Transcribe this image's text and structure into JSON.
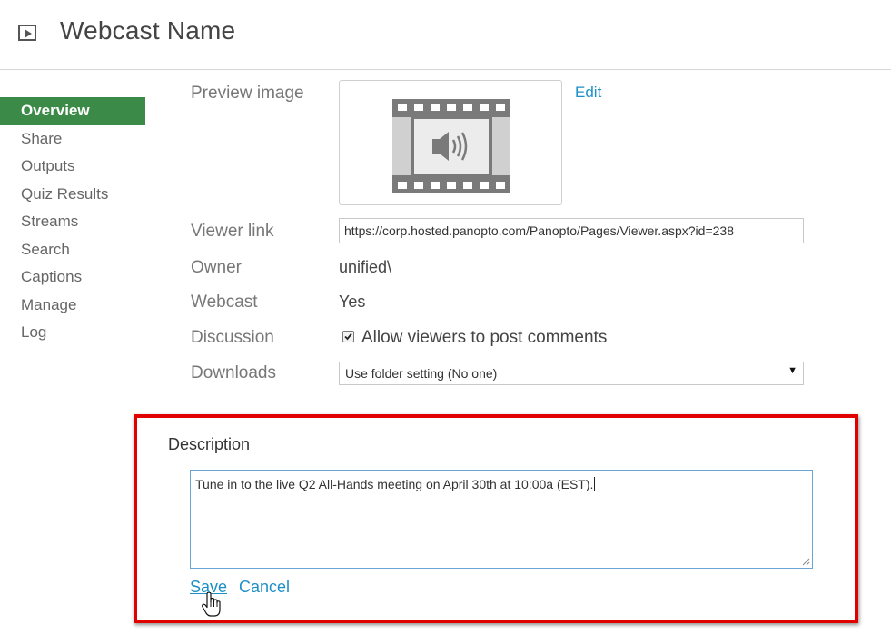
{
  "header": {
    "title": "Webcast Name",
    "icon": "play-square-icon"
  },
  "sidebar": {
    "items": [
      {
        "label": "Overview",
        "active": true
      },
      {
        "label": "Share"
      },
      {
        "label": "Outputs"
      },
      {
        "label": "Quiz Results"
      },
      {
        "label": "Streams"
      },
      {
        "label": "Search"
      },
      {
        "label": "Captions"
      },
      {
        "label": "Manage"
      },
      {
        "label": "Log"
      }
    ],
    "active_color": "#3c8a47"
  },
  "details": {
    "preview_image_label": "Preview image",
    "preview_icon": "video-film-audio-icon",
    "edit_label": "Edit",
    "viewer_link_label": "Viewer link",
    "viewer_link_value": "https://corp.hosted.panopto.com/Panopto/Pages/Viewer.aspx?id=238",
    "owner_label": "Owner",
    "owner_value": "unified\\",
    "webcast_label": "Webcast",
    "webcast_value": "Yes",
    "discussion_label": "Discussion",
    "discussion_checkbox_label": "Allow viewers to post comments",
    "discussion_checked": true,
    "downloads_label": "Downloads",
    "downloads_value": "Use folder setting (No one)"
  },
  "description": {
    "label": "Description",
    "text": "Tune in to the live Q2 All-Hands meeting on April 30th at 10:00a (EST).",
    "save_label": "Save",
    "cancel_label": "Cancel"
  },
  "colors": {
    "link": "#1e8fc6",
    "highlight_border": "#e00000"
  }
}
